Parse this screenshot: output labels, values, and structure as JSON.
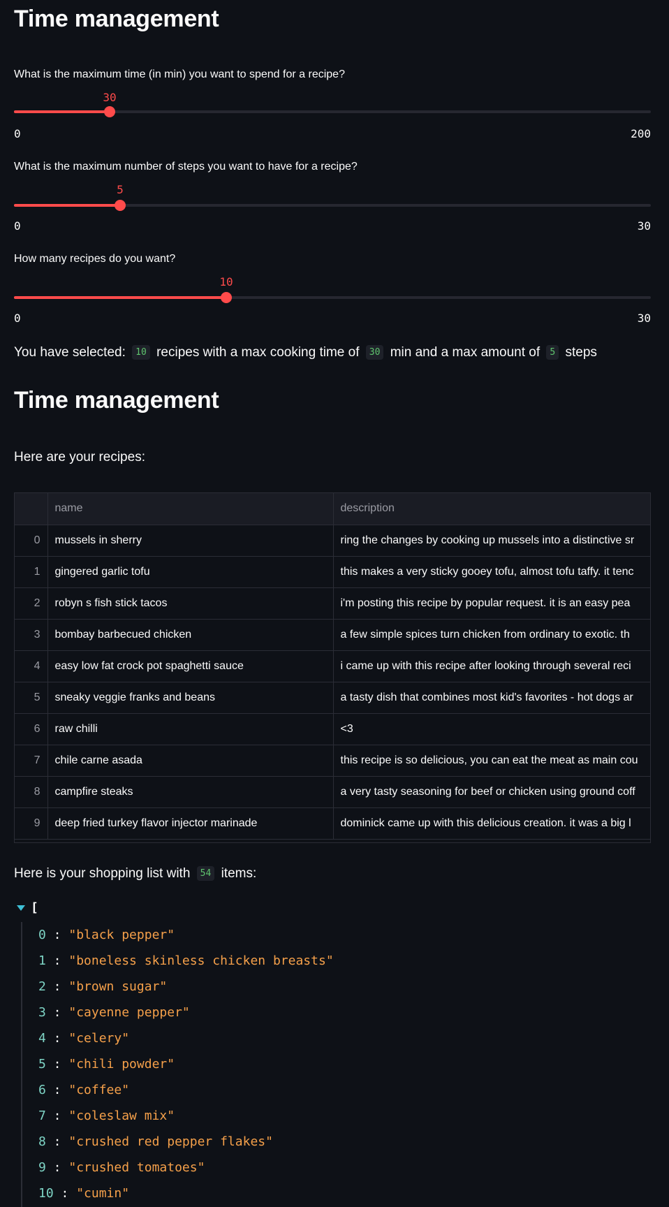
{
  "top_title": "Time management",
  "sliders": [
    {
      "label": "What is the maximum time (in min) you want to spend for a recipe?",
      "value": "30",
      "min": "0",
      "max": "200",
      "fraction": 0.15
    },
    {
      "label": "What is the maximum number of steps you want to have for a recipe?",
      "value": "5",
      "min": "0",
      "max": "30",
      "fraction": 0.1667
    },
    {
      "label": "How many recipes do you want?",
      "value": "10",
      "min": "0",
      "max": "30",
      "fraction": 0.3333
    }
  ],
  "summary": {
    "prefix": "You have selected:",
    "recipes": "10",
    "mid1": "recipes with a max cooking time of",
    "time": "30",
    "mid2": "min and a max amount of",
    "steps": "5",
    "suffix": "steps"
  },
  "second_title": "Time management",
  "recipes_intro": "Here are your recipes:",
  "table": {
    "columns": [
      "",
      "name",
      "description"
    ],
    "rows": [
      {
        "idx": "0",
        "name": "mussels in sherry",
        "description": "ring the changes by cooking up mussels into a distinctive sr"
      },
      {
        "idx": "1",
        "name": "gingered garlic tofu",
        "description": "this makes a very sticky gooey tofu, almost tofu taffy. it tenc"
      },
      {
        "idx": "2",
        "name": "robyn s fish stick tacos",
        "description": "i'm posting this recipe by popular request.  it is an easy pea"
      },
      {
        "idx": "3",
        "name": "bombay barbecued chicken",
        "description": "a few simple spices turn chicken from ordinary to exotic. th"
      },
      {
        "idx": "4",
        "name": "easy low fat crock pot spaghetti sauce",
        "description": "i came up with this recipe after looking through several reci"
      },
      {
        "idx": "5",
        "name": "sneaky veggie franks and beans",
        "description": "a tasty dish that combines most kid's favorites - hot dogs ar"
      },
      {
        "idx": "6",
        "name": "raw chilli",
        "description": "<3"
      },
      {
        "idx": "7",
        "name": "chile carne asada",
        "description": "this recipe is so delicious, you can eat the meat as main cou"
      },
      {
        "idx": "8",
        "name": "campfire steaks",
        "description": "a very tasty seasoning for beef or chicken using ground coff"
      },
      {
        "idx": "9",
        "name": "deep fried turkey flavor injector marinade",
        "description": "dominick came up with this delicious creation. it was a big l"
      }
    ]
  },
  "shopping": {
    "prefix": "Here is your shopping list with",
    "count": "54",
    "suffix": "items:"
  },
  "json_viewer": {
    "open_bracket": "[",
    "items": [
      {
        "key": "0",
        "value": "\"black pepper\""
      },
      {
        "key": "1",
        "value": "\"boneless skinless chicken breasts\""
      },
      {
        "key": "2",
        "value": "\"brown sugar\""
      },
      {
        "key": "3",
        "value": "\"cayenne pepper\""
      },
      {
        "key": "4",
        "value": "\"celery\""
      },
      {
        "key": "5",
        "value": "\"chili powder\""
      },
      {
        "key": "6",
        "value": "\"coffee\""
      },
      {
        "key": "7",
        "value": "\"coleslaw mix\""
      },
      {
        "key": "8",
        "value": "\"crushed red pepper flakes\""
      },
      {
        "key": "9",
        "value": "\"crushed tomatoes\""
      },
      {
        "key": "10",
        "value": "\"cumin\""
      }
    ]
  },
  "colors": {
    "background": "#0e1117",
    "accent": "#ff4b4b",
    "code_green": "#5fc46e",
    "json_key": "#7ed4c5",
    "json_string": "#f5a04a"
  }
}
